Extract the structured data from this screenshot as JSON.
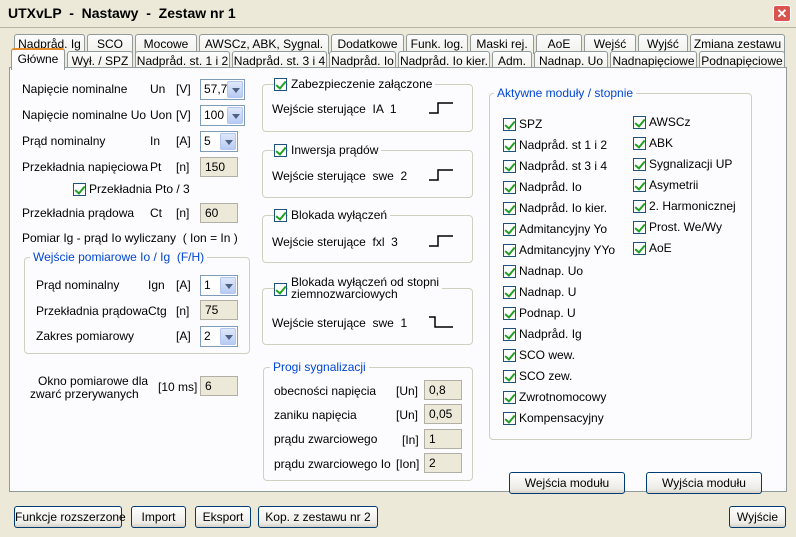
{
  "window": {
    "title": "UTXvLP  -  Nastawy  -  Zestaw nr 1",
    "close": "✕"
  },
  "tabs_row1": [
    "Nadpråd. Ig",
    "SCO",
    "Mocowe",
    "AWSCz, ABK, Sygnal.",
    "Dodatkowe",
    "Funk. log.",
    "Maski rej.",
    "AoE",
    "Wejść",
    "Wyjść",
    "Zmiana zestawu"
  ],
  "tabs_row2": [
    "Główne",
    "Wył. / SPZ",
    "Nadpråd. st. 1 i 2",
    "Nadpråd. st. 3 i 4",
    "Nadpråd. Io",
    "Nadpråd. Io kier.",
    "Adm.",
    "Nadnap. Uo",
    "Nadnapięciowe",
    "Podnapięciowe"
  ],
  "left": {
    "un": {
      "label": "Napięcie nominalne",
      "sym": "Un",
      "unit": "[V]",
      "value": "57,7"
    },
    "uon": {
      "label": "Napięcie nominalne Uo",
      "sym": "Uon",
      "unit": "[V]",
      "value": "100"
    },
    "in": {
      "label": "Prąd nominalny",
      "sym": "In",
      "unit": "[A]",
      "value": "5"
    },
    "pt": {
      "label": "Przekładnia napięciowa",
      "sym": "Pt",
      "unit": "[n]",
      "value": "150"
    },
    "pto": {
      "label": "Przekładnia Pto / 3",
      "checked": true
    },
    "ct": {
      "label": "Przekładnia prądowa",
      "sym": "Ct",
      "unit": "[n]",
      "value": "60"
    },
    "pomiar": "Pomiar Ig - prąd Io wyliczany  ( Ion = In )",
    "io_group": {
      "title": "Wejście pomiarowe Io / Ig  (F/H)",
      "ign": {
        "label": "Prąd nominalny",
        "sym": "Ign",
        "unit": "[A]",
        "value": "1"
      },
      "ctg": {
        "label": "Przekładnia prądowa",
        "sym": "Ctg",
        "unit": "[n]",
        "value": "75"
      },
      "zakres": {
        "label": "Zakres pomiarowy",
        "unit": "[A]",
        "value": "2"
      }
    },
    "okno": {
      "label1": "Okno pomiarowe dla",
      "label2": "zwarć przerywanych",
      "unit": "[10 ms]",
      "value": "6"
    }
  },
  "middle": {
    "zab": {
      "label": "Zabezpieczenie załączone",
      "input": "Wejście sterujące  IA  1"
    },
    "inw": {
      "label": "Inwersja prądów",
      "input": "Wejście sterujące  swe  2"
    },
    "blk": {
      "label": "Blokada wyłączeń",
      "input": "Wejście sterujące  fxl  3"
    },
    "blk2": {
      "label1": "Blokada wyłączeń od stopni",
      "label2": "ziemnozwarciowych",
      "input": "Wejście sterujące  swe  1"
    },
    "progi": {
      "title": "Progi sygnalizacji",
      "rows": [
        {
          "label": "obecności napięcia",
          "unit": "[Un]",
          "value": "0,8"
        },
        {
          "label": "zaniku napięcia",
          "unit": "[Un]",
          "value": "0,05"
        },
        {
          "label": "prądu zwarciowego",
          "unit": "[In]",
          "value": "1"
        },
        {
          "label": "prądu zwarciowego Io",
          "unit": "[Ion]",
          "value": "2"
        }
      ]
    }
  },
  "modules": {
    "title": "Aktywne moduły / stopnie",
    "col1": [
      "SPZ",
      "Nadpråd. st 1 i 2",
      "Nadpråd. st 3 i 4",
      "Nadpråd. Io",
      "Nadpråd. Io kier.",
      "Admitancyjny Yo",
      "Admitancyjny YYo",
      "Nadnap. Uo",
      "Nadnap. U",
      "Podnap. U",
      "Nadpråd. Ig",
      "SCO wew.",
      "SCO zew.",
      "Zwrotnomocowy",
      "Kompensacyjny"
    ],
    "col2": [
      "AWSCz",
      "ABK",
      "Sygnalizacji UP",
      "Asymetrii",
      "2. Harmonicznej",
      "Prost. We/Wy",
      "AoE"
    ],
    "btn_in": "Wejścia modułu",
    "btn_out": "Wyjścia modułu"
  },
  "bottom": {
    "funkcje": "Funkcje rozszerzone",
    "import": "Import",
    "export": "Eksport",
    "kop": "Kop. z zestawu nr 2",
    "exit": "Wyjście"
  }
}
